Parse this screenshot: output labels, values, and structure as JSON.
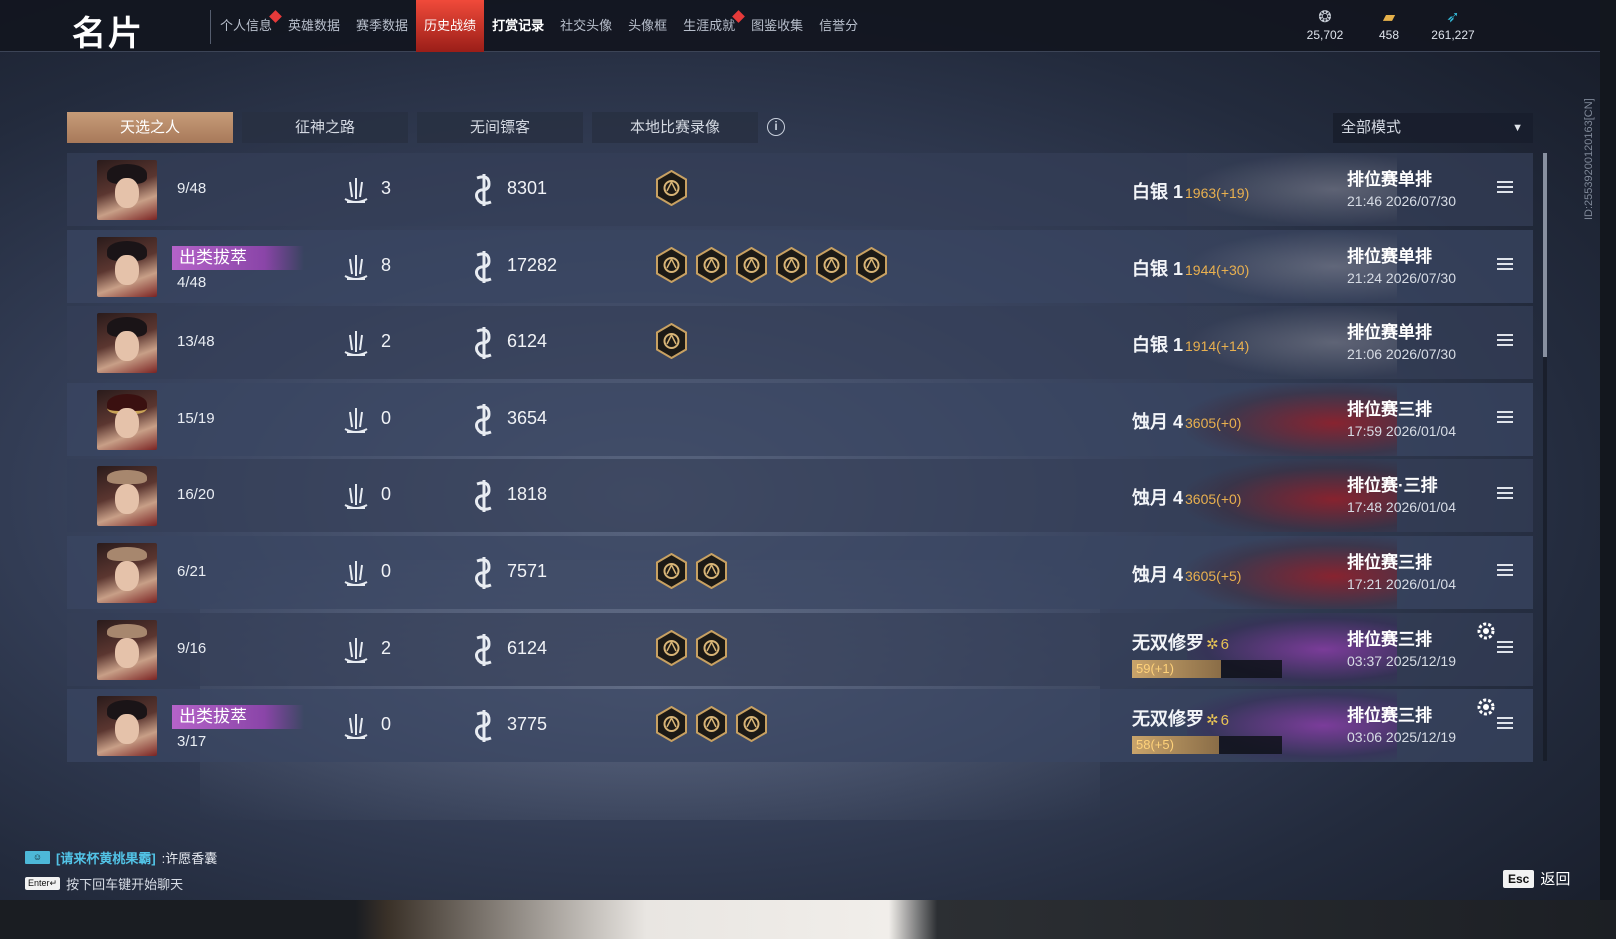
{
  "brand": "名片",
  "nav": [
    {
      "label": "个人信息",
      "dot": true
    },
    {
      "label": "英雄数据"
    },
    {
      "label": "赛季数据"
    },
    {
      "label": "历史战绩",
      "active": true
    },
    {
      "label": "打赏记录",
      "bold": true
    },
    {
      "label": "社交头像"
    },
    {
      "label": "头像框"
    },
    {
      "label": "生涯成就",
      "dot": true
    },
    {
      "label": "图鉴收集"
    },
    {
      "label": "信誉分"
    }
  ],
  "currencies": [
    {
      "icon": "coin-stack-icon",
      "value": "25,702"
    },
    {
      "icon": "ticket-icon",
      "value": "458"
    },
    {
      "icon": "feather-icon",
      "value": "261,227"
    }
  ],
  "side_id": "ID:2553920012016​3[CN]",
  "tabs": [
    "天选之人",
    "征神之路",
    "无间镖客",
    "本地比赛录像"
  ],
  "mode_select": "全部模式",
  "badge_text": "出类拔萃",
  "matches": [
    {
      "avatar": "hair",
      "place": "9/48",
      "kills": "3",
      "damage": "8301",
      "medals": 1,
      "rank": "白银 1",
      "points": "1963(+19)",
      "mode": "排位赛单排",
      "time": "21:46  2026/07/30",
      "bg": "grey"
    },
    {
      "avatar": "hair",
      "badge": true,
      "place": "4/48",
      "kills": "8",
      "damage": "17282",
      "medals": 6,
      "rank": "白银 1",
      "points": "1944(+30)",
      "mode": "排位赛单排",
      "time": "21:24  2026/07/30",
      "bg": "grey"
    },
    {
      "avatar": "hair",
      "place": "13/48",
      "kills": "2",
      "damage": "6124",
      "medals": 1,
      "rank": "白银 1",
      "points": "1914(+14)",
      "mode": "排位赛单排",
      "time": "21:06  2026/07/30",
      "bg": "grey"
    },
    {
      "avatar": "hat",
      "place": "15/19",
      "kills": "0",
      "damage": "3654",
      "medals": 0,
      "rank": "蚀月 4",
      "points": "3605(+0)",
      "mode": "排位赛三排",
      "time": "17:59  2026/01/04",
      "bg": "red"
    },
    {
      "avatar": "bald",
      "place": "16/20",
      "kills": "0",
      "damage": "1818",
      "medals": 0,
      "rank": "蚀月 4",
      "points": "3605(+0)",
      "mode": "排位赛·三排",
      "time": "17:48  2026/01/04",
      "bg": "red"
    },
    {
      "avatar": "bald",
      "place": "6/21",
      "kills": "0",
      "damage": "7571",
      "medals": 2,
      "rank": "蚀月 4",
      "points": "3605(+5)",
      "mode": "排位赛三排",
      "time": "17:21  2026/01/04",
      "bg": "red"
    },
    {
      "avatar": "bald",
      "place": "9/16",
      "kills": "2",
      "damage": "6124",
      "medals": 2,
      "rank": "无双修罗",
      "level": "6",
      "bar": "59(+1)",
      "bar_fill": 0.59,
      "mode": "排位赛三排",
      "time": "03:37  2025/12/19",
      "bg": "purple",
      "gear": true
    },
    {
      "avatar": "hair",
      "badge": true,
      "place": "3/17",
      "kills": "0",
      "damage": "3775",
      "medals": 3,
      "rank": "无双修罗",
      "level": "6",
      "bar": "58(+5)",
      "bar_fill": 0.58,
      "mode": "排位赛三排",
      "time": "03:06  2025/12/19",
      "bg": "purple",
      "gear": true
    }
  ],
  "chat": {
    "channel": "[请来杯黄桃果霸]",
    "message": ":许愿香囊",
    "hint": "按下回车键开始聊天",
    "enter_key": "Enter↵"
  },
  "esc_key": "Esc",
  "back_label": "返回"
}
